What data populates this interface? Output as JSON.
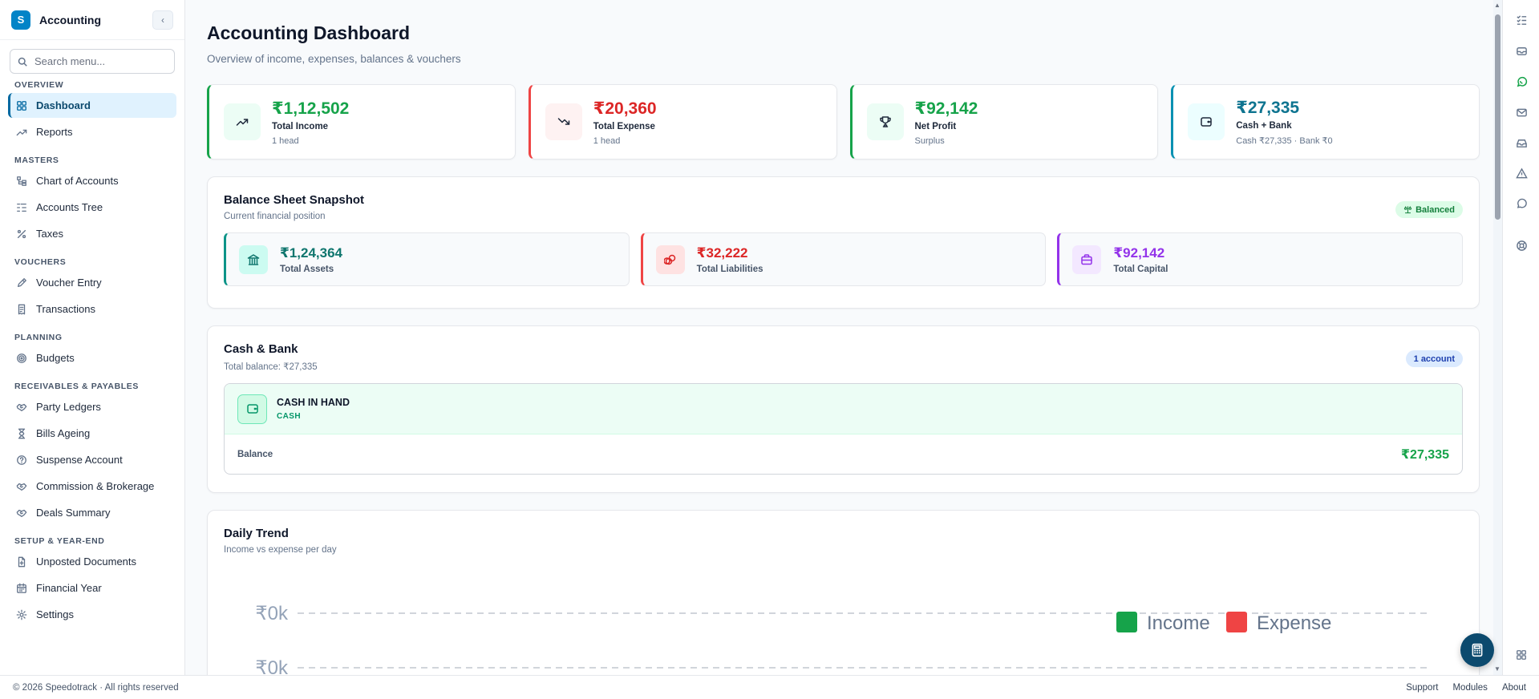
{
  "app": {
    "logo_letter": "S",
    "title": "Accounting",
    "collapse_glyph": "‹"
  },
  "search": {
    "placeholder": "Search menu..."
  },
  "nav": {
    "sections": [
      {
        "title": "OVERVIEW",
        "items": [
          {
            "label": "Dashboard",
            "icon": "grid-icon",
            "active": true
          },
          {
            "label": "Reports",
            "icon": "trend-icon"
          }
        ]
      },
      {
        "title": "MASTERS",
        "items": [
          {
            "label": "Chart of Accounts",
            "icon": "hierarchy-icon"
          },
          {
            "label": "Accounts Tree",
            "icon": "list-tree-icon"
          },
          {
            "label": "Taxes",
            "icon": "percent-icon"
          }
        ]
      },
      {
        "title": "VOUCHERS",
        "items": [
          {
            "label": "Voucher Entry",
            "icon": "pen-icon"
          },
          {
            "label": "Transactions",
            "icon": "receipt-icon"
          }
        ]
      },
      {
        "title": "PLANNING",
        "items": [
          {
            "label": "Budgets",
            "icon": "target-icon"
          }
        ]
      },
      {
        "title": "RECEIVABLES & PAYABLES",
        "items": [
          {
            "label": "Party Ledgers",
            "icon": "handshake-icon"
          },
          {
            "label": "Bills Ageing",
            "icon": "hourglass-icon"
          },
          {
            "label": "Suspense Account",
            "icon": "question-icon"
          },
          {
            "label": "Commission & Brokerage",
            "icon": "handshake-icon"
          },
          {
            "label": "Deals Summary",
            "icon": "handshake-icon"
          }
        ]
      },
      {
        "title": "SETUP & YEAR-END",
        "items": [
          {
            "label": "Unposted Documents",
            "icon": "document-icon"
          },
          {
            "label": "Financial Year",
            "icon": "calendar-icon"
          },
          {
            "label": "Settings",
            "icon": "gear-icon"
          }
        ]
      }
    ]
  },
  "header": {
    "title": "Accounting Dashboard",
    "subtitle": "Overview of income, expenses, balances & vouchers"
  },
  "kpis": [
    {
      "value": "₹1,12,502",
      "label": "Total Income",
      "sub": "1 head",
      "color": "#16a34a",
      "accent": "#16a34a",
      "bg": "#ecfdf5",
      "icon": "trend-up-icon"
    },
    {
      "value": "₹20,360",
      "label": "Total Expense",
      "sub": "1 head",
      "color": "#dc2626",
      "accent": "#ef4444",
      "bg": "#fef2f2",
      "icon": "trend-down-icon"
    },
    {
      "value": "₹92,142",
      "label": "Net Profit",
      "sub": "Surplus",
      "color": "#16a34a",
      "accent": "#16a34a",
      "bg": "#ecfdf5",
      "icon": "trophy-icon"
    },
    {
      "value": "₹27,335",
      "label": "Cash + Bank",
      "sub": "Cash ₹27,335 · Bank ₹0",
      "color": "#0e7490",
      "accent": "#0891b2",
      "bg": "#ecfeff",
      "icon": "wallet-icon"
    }
  ],
  "balance_sheet": {
    "title": "Balance Sheet Snapshot",
    "subtitle": "Current financial position",
    "badge": "Balanced",
    "items": [
      {
        "value": "₹1,24,364",
        "label": "Total Assets",
        "color": "#0f766e",
        "accent": "#0d9488",
        "bg": "#ccfbf1",
        "icon": "bank-icon"
      },
      {
        "value": "₹32,222",
        "label": "Total Liabilities",
        "color": "#dc2626",
        "accent": "#ef4444",
        "bg": "#fee2e2",
        "icon": "coins-icon"
      },
      {
        "value": "₹92,142",
        "label": "Total Capital",
        "color": "#9333ea",
        "accent": "#9333ea",
        "bg": "#f3e8ff",
        "icon": "briefcase-icon"
      }
    ]
  },
  "cash_bank": {
    "title": "Cash & Bank",
    "subtitle": "Total balance: ₹27,335",
    "badge": "1 account",
    "account": {
      "name": "CASH IN HAND",
      "type": "CASH",
      "balance_label": "Balance",
      "balance": "₹27,335"
    }
  },
  "daily_trend": {
    "title": "Daily Trend",
    "subtitle": "Income vs expense per day"
  },
  "chart_data": {
    "type": "line",
    "title": "Daily Trend",
    "subtitle": "Income vs expense per day",
    "y_tick_labels": [
      "₹0k",
      "₹0k"
    ],
    "series": [
      {
        "name": "Income",
        "color": "#16a34a",
        "values": []
      },
      {
        "name": "Expense",
        "color": "#ef4444",
        "values": []
      }
    ],
    "legend": "top-right",
    "grid": true
  },
  "rail": [
    "checklist-icon",
    "inbox-icon",
    "whatsapp-icon",
    "mail-icon",
    "tray-icon",
    "alert-icon",
    "chat-icon",
    "support-icon",
    "apps-icon"
  ],
  "footer": {
    "copyright": "© 2026 Speedotrack · All rights reserved",
    "links": [
      "Support",
      "Modules",
      "About"
    ]
  }
}
